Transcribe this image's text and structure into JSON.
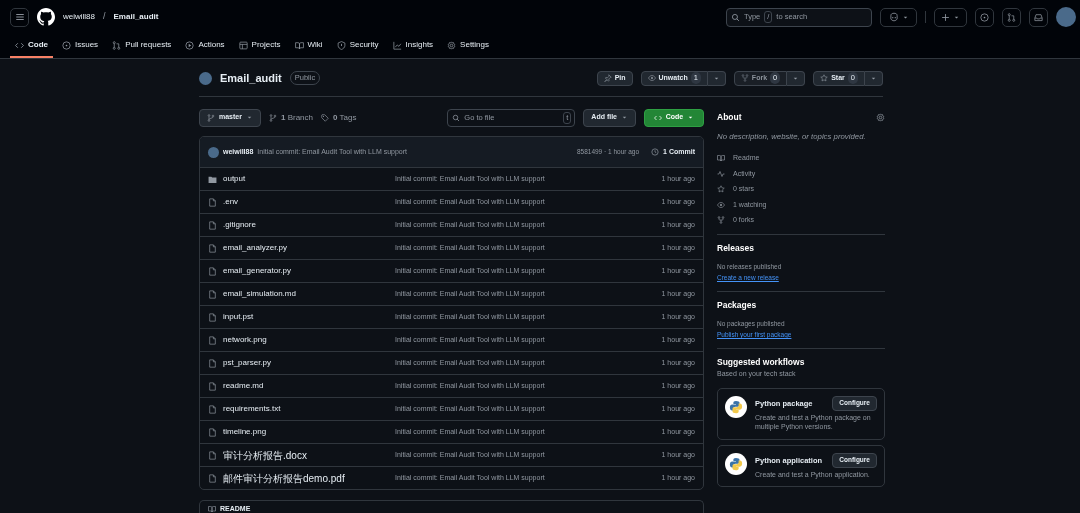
{
  "header": {
    "owner": "weiwill88",
    "separator": "/",
    "repo": "Email_audit",
    "search": {
      "before": "Type",
      "key": "/",
      "after": "to search"
    }
  },
  "nav_tabs": [
    {
      "label": "Code",
      "selected": true
    },
    {
      "label": "Issues",
      "selected": false
    },
    {
      "label": "Pull requests",
      "selected": false
    },
    {
      "label": "Actions",
      "selected": false
    },
    {
      "label": "Projects",
      "selected": false
    },
    {
      "label": "Wiki",
      "selected": false
    },
    {
      "label": "Security",
      "selected": false
    },
    {
      "label": "Insights",
      "selected": false
    },
    {
      "label": "Settings",
      "selected": false
    }
  ],
  "repo": {
    "name": "Email_audit",
    "visibility": "Public",
    "actions": [
      {
        "label": "Pin",
        "disabled": false
      },
      {
        "label": "Unwatch",
        "count": "1",
        "disabled": false
      },
      {
        "label": "Fork",
        "count": "0",
        "disabled": true
      },
      {
        "label": "Star",
        "count": "0",
        "disabled": false
      }
    ]
  },
  "toolbar": {
    "branch": "master",
    "branches": "**1** Branch",
    "tags": "**0** Tags",
    "go_to_file": {
      "placeholder": "Go to file",
      "key": "t"
    },
    "add_file": "Add file",
    "code": "Code"
  },
  "latest_commit": {
    "author": "weiwill88",
    "message": "Initial commit: Email Audit Tool with LLM support",
    "hash_time": "8581499 · 1 hour ago",
    "commits": "1 Commit"
  },
  "files": [
    {
      "name": "output",
      "kind": "folder",
      "message": "Initial commit: Email Audit Tool with LLM support",
      "time": "1 hour ago"
    },
    {
      "name": ".env",
      "kind": "file",
      "message": "Initial commit: Email Audit Tool with LLM support",
      "time": "1 hour ago"
    },
    {
      "name": ".gitignore",
      "kind": "file",
      "message": "Initial commit: Email Audit Tool with LLM support",
      "time": "1 hour ago"
    },
    {
      "name": "email_analyzer.py",
      "kind": "file",
      "message": "Initial commit: Email Audit Tool with LLM support",
      "time": "1 hour ago"
    },
    {
      "name": "email_generator.py",
      "kind": "file",
      "message": "Initial commit: Email Audit Tool with LLM support",
      "time": "1 hour ago"
    },
    {
      "name": "email_simulation.md",
      "kind": "file",
      "message": "Initial commit: Email Audit Tool with LLM support",
      "time": "1 hour ago"
    },
    {
      "name": "input.pst",
      "kind": "file",
      "message": "Initial commit: Email Audit Tool with LLM support",
      "time": "1 hour ago"
    },
    {
      "name": "network.png",
      "kind": "file",
      "message": "Initial commit: Email Audit Tool with LLM support",
      "time": "1 hour ago"
    },
    {
      "name": "pst_parser.py",
      "kind": "file",
      "message": "Initial commit: Email Audit Tool with LLM support",
      "time": "1 hour ago"
    },
    {
      "name": "readme.md",
      "kind": "file",
      "message": "Initial commit: Email Audit Tool with LLM support",
      "time": "1 hour ago"
    },
    {
      "name": "requirements.txt",
      "kind": "file",
      "message": "Initial commit: Email Audit Tool with LLM support",
      "time": "1 hour ago"
    },
    {
      "name": "timeline.png",
      "kind": "file",
      "message": "Initial commit: Email Audit Tool with LLM support",
      "time": "1 hour ago"
    },
    {
      "name": "审计分析报告.docx",
      "kind": "file",
      "message": "Initial commit: Email Audit Tool with LLM support",
      "time": "1 hour ago"
    },
    {
      "name": "邮件审计分析报告demo.pdf",
      "kind": "file",
      "message": "Initial commit: Email Audit Tool with LLM support",
      "time": "1 hour ago"
    }
  ],
  "readme": {
    "title": "README"
  },
  "about": {
    "title": "About",
    "description": "No description, website, or topics provided.",
    "links": [
      {
        "label": "Readme"
      },
      {
        "label": "Activity"
      },
      {
        "label": "0 stars"
      },
      {
        "label": "1 watching"
      },
      {
        "label": "0 forks"
      }
    ]
  },
  "releases": {
    "title": "Releases",
    "text": "No releases published",
    "link": "Create a new release"
  },
  "packages": {
    "title": "Packages",
    "text": "No packages published",
    "link": "Publish your first package"
  },
  "workflows": {
    "title": "Suggested workflows",
    "subtitle": "Based on your tech stack",
    "items": [
      {
        "name": "Python package",
        "description": "Create and test a Python package on multiple Python versions.",
        "button": "Configure"
      },
      {
        "name": "Python application",
        "description": "Create and test a Python application.",
        "button": "Configure"
      }
    ]
  }
}
